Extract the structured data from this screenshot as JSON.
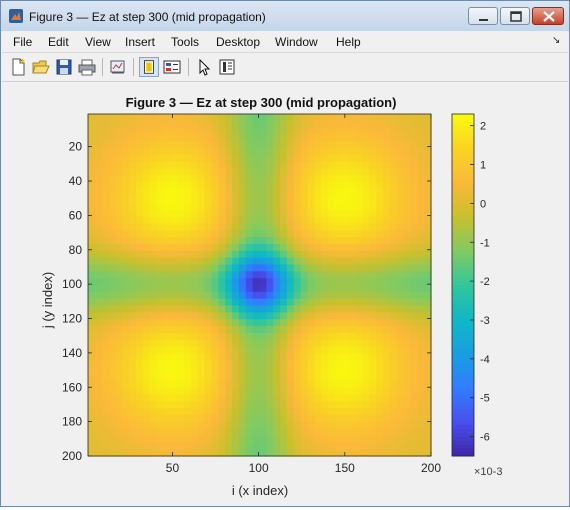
{
  "window": {
    "title": "Figure 3 — Ez at step 300 (mid propagation)"
  },
  "menu": {
    "items": [
      {
        "label": "File"
      },
      {
        "label": "Edit"
      },
      {
        "label": "View"
      },
      {
        "label": "Insert"
      },
      {
        "label": "Tools"
      },
      {
        "label": "Desktop"
      },
      {
        "label": "Window"
      },
      {
        "label": "Help"
      }
    ]
  },
  "toolbar": {
    "icons": [
      "new-figure-icon",
      "open-file-icon",
      "save-icon",
      "print-icon",
      "link-plot-icon",
      "hide-plot-tools-icon",
      "show-plot-tools-icon",
      "edit-plot-arrow-icon",
      "insert-colorbar-icon"
    ]
  },
  "colors": {
    "parula_dark": "#3e26a8",
    "parula_cyan": "#1fb9b0",
    "parula_yellow": "#f9fb0e"
  },
  "chart_data": {
    "type": "heatmap",
    "title": "Figure 3 — Ez at step 300 (mid propagation)",
    "xlabel": "i (x index)",
    "ylabel": "j (y index)",
    "xlim": [
      1,
      200
    ],
    "ylim": [
      1,
      200
    ],
    "y_reversed": true,
    "xticks": [
      50,
      100,
      150,
      200
    ],
    "yticks": [
      20,
      40,
      60,
      80,
      100,
      120,
      140,
      160,
      180,
      200
    ],
    "colormap": "parula",
    "colorbar": {
      "clim": [
        -0.0065,
        0.0023
      ],
      "ticks": [
        2,
        1,
        0,
        -1,
        -2,
        -3,
        -4,
        -5,
        -6
      ],
      "exponent": "×10-3"
    },
    "features": {
      "center_min": {
        "i": 100,
        "j": 100,
        "value": -0.0065
      },
      "corner_maxima": [
        {
          "i": 50,
          "j": 50,
          "value": 0.0022
        },
        {
          "i": 150,
          "j": 50,
          "value": 0.0022
        },
        {
          "i": 50,
          "j": 150,
          "value": 0.0022
        },
        {
          "i": 150,
          "j": 150,
          "value": 0.0022
        }
      ],
      "background_value": 0.0
    }
  }
}
